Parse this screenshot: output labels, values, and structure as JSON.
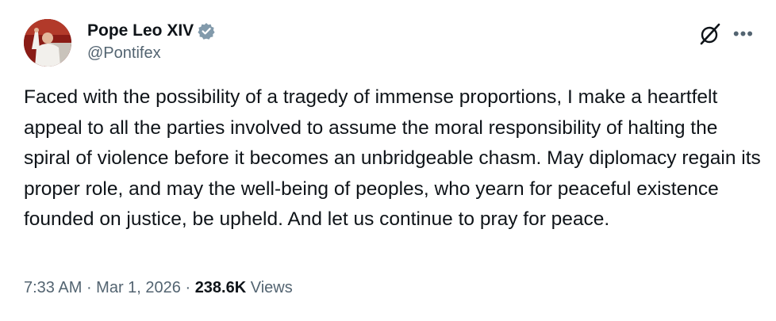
{
  "author": {
    "display_name": "Pope Leo XIV",
    "handle": "@Pontifex",
    "verified": true
  },
  "post": {
    "text": "Faced with the possibility of a tragedy of immense proportions, I make a heartfelt appeal to all the parties involved to assume the moral responsibility of halting the spiral of violence before it becomes an unbridgeable chasm. May diplomacy regain its proper role, and may the well-being of peoples, who yearn for peaceful existence founded on justice, be upheld. And let us continue to pray for peace."
  },
  "meta": {
    "time": "7:33 AM",
    "separator": " · ",
    "date": "Mar 1, 2026",
    "views_count": "238.6K",
    "views_label": " Views"
  },
  "colors": {
    "verified_badge": "#829aab",
    "secondary_text": "#536471",
    "primary_text": "#0f1419"
  },
  "icons": {
    "top_right": [
      "grok-icon",
      "more-icon"
    ]
  }
}
